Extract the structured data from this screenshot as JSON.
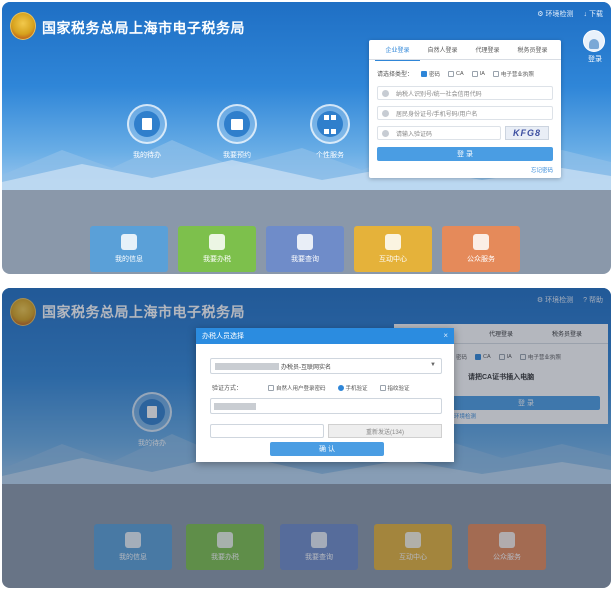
{
  "site": {
    "title": "国家税务总局上海市电子税务局"
  },
  "toplinks": [
    {
      "label": "环境检测",
      "icon": "gear-icon"
    },
    {
      "label": "下载",
      "icon": "download-icon"
    },
    {
      "label": "帮助",
      "icon": "help-icon"
    }
  ],
  "login_label": "登录",
  "circles": [
    {
      "label": "我的待办",
      "icon": "todo-icon"
    },
    {
      "label": "我要预约",
      "icon": "calendar-icon"
    },
    {
      "label": "个性服务",
      "icon": "grid-icon"
    }
  ],
  "tiles": [
    {
      "label": "我的信息",
      "color": "#5aa0d8"
    },
    {
      "label": "我要办税",
      "color": "#7dc04c"
    },
    {
      "label": "我要查询",
      "color": "#6f8cc9"
    },
    {
      "label": "互动中心",
      "color": "#e5b23a"
    },
    {
      "label": "公众服务",
      "color": "#e58a5a"
    }
  ],
  "login_panel": {
    "tabs": [
      "企业登录",
      "自然人登录",
      "代理登录",
      "税务员登录"
    ],
    "auth_label": "请选择类型：",
    "auth_options": [
      "密码",
      "CA",
      "IA",
      "电子营业执照"
    ],
    "taxpayer_placeholder": "纳税人识别号/统一社会信用代码",
    "id_placeholder": "居民身份证号/手机号码/用户名",
    "captcha_placeholder": "请输入验证码",
    "captcha_text": "KFG8",
    "submit": "登 录",
    "forgot": "忘记密码"
  },
  "modal": {
    "title": "办税人员选择",
    "close": "×",
    "select_suffix": "办税员-互联网实名",
    "verify_label": "验证方式：",
    "verify_options": [
      "自然人用户登录密码",
      "手机验证",
      "指纹验证"
    ],
    "resend": "重新发送(134)",
    "confirm": "确 认"
  },
  "background2": {
    "tabs": [
      "自然人登录",
      "代理登录",
      "税务员登录"
    ],
    "options": [
      "密码",
      "CA",
      "IA",
      "电子营业执照"
    ],
    "ca_prompt": "请把CA证书插入电脑",
    "submit": "登 录",
    "env_check": "环境检测"
  }
}
